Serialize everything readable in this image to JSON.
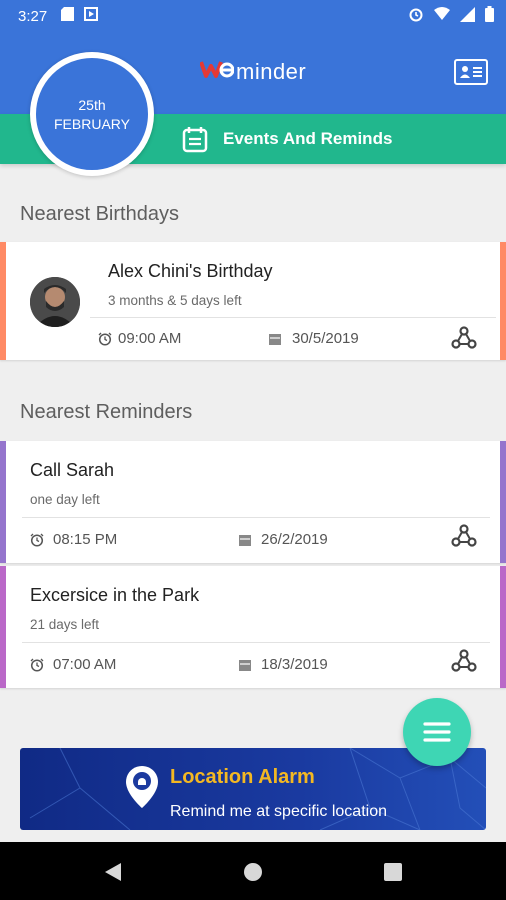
{
  "status_bar": {
    "time": "3:27"
  },
  "app": {
    "logo_text": "minder",
    "section_title": "Events And Reminds"
  },
  "date": {
    "day": "25th",
    "month": "FEBRUARY"
  },
  "birthdays": {
    "title": "Nearest Birthdays",
    "items": [
      {
        "name": "Alex Chini's Birthday",
        "remaining": "3 months & 5 days left",
        "time": "09:00 AM",
        "date": "30/5/2019",
        "accent": "#ff8a65"
      }
    ]
  },
  "reminders": {
    "title": "Nearest Reminders",
    "items": [
      {
        "name": "Call Sarah",
        "remaining": "one day left",
        "time": "08:15 PM",
        "date": "26/2/2019",
        "accent": "#9575cd"
      },
      {
        "name": "Excersice in the Park",
        "remaining": "21 days left",
        "time": "07:00 AM",
        "date": "18/3/2019",
        "accent": "#ba68c8"
      }
    ]
  },
  "banner": {
    "title": "Location Alarm",
    "subtitle": "Remind me at specific location"
  },
  "colors": {
    "primary": "#3a74d9",
    "teal": "#21b78d",
    "fab": "#3ed6b4"
  }
}
